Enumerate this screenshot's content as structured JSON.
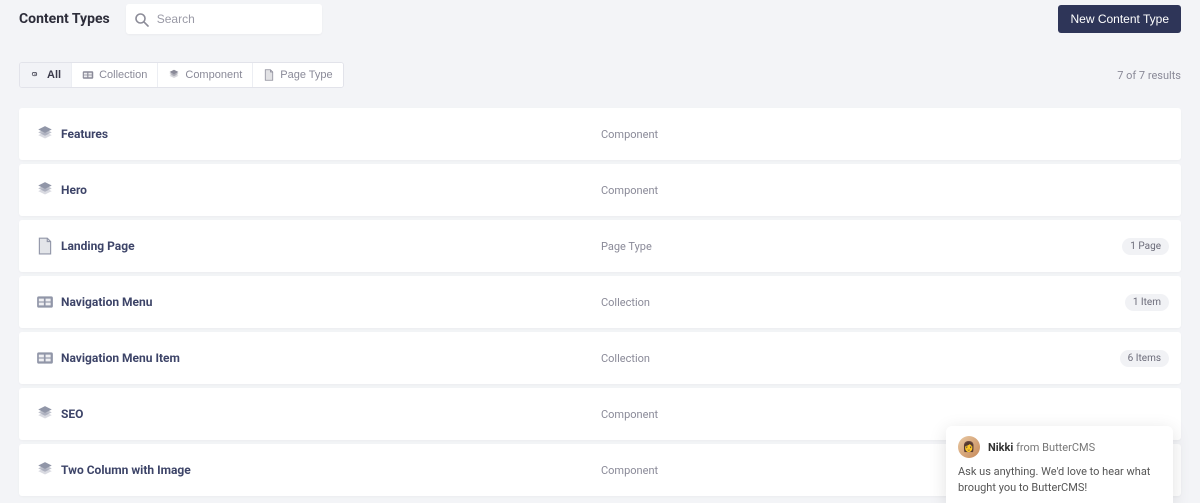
{
  "header": {
    "title": "Content Types",
    "search_placeholder": "Search",
    "new_button": "New Content Type"
  },
  "filters": {
    "items": [
      {
        "label": "All",
        "icon": "link"
      },
      {
        "label": "Collection",
        "icon": "collection"
      },
      {
        "label": "Component",
        "icon": "component"
      },
      {
        "label": "Page Type",
        "icon": "page"
      }
    ],
    "active_index": 0
  },
  "results": {
    "count_text": "7 of 7 results"
  },
  "rows": [
    {
      "name": "Features",
      "type": "Component",
      "icon": "component",
      "badge": null
    },
    {
      "name": "Hero",
      "type": "Component",
      "icon": "component",
      "badge": null
    },
    {
      "name": "Landing Page",
      "type": "Page Type",
      "icon": "page",
      "badge": "1 Page"
    },
    {
      "name": "Navigation Menu",
      "type": "Collection",
      "icon": "collection",
      "badge": "1 Item"
    },
    {
      "name": "Navigation Menu Item",
      "type": "Collection",
      "icon": "collection",
      "badge": "6 Items"
    },
    {
      "name": "SEO",
      "type": "Component",
      "icon": "component",
      "badge": null
    },
    {
      "name": "Two Column with Image",
      "type": "Component",
      "icon": "component",
      "badge": null
    }
  ],
  "chat": {
    "sender": "Nikki",
    "from_text": "from ButterCMS",
    "message": "Ask us anything. We'd love to hear what brought you to ButterCMS!"
  }
}
